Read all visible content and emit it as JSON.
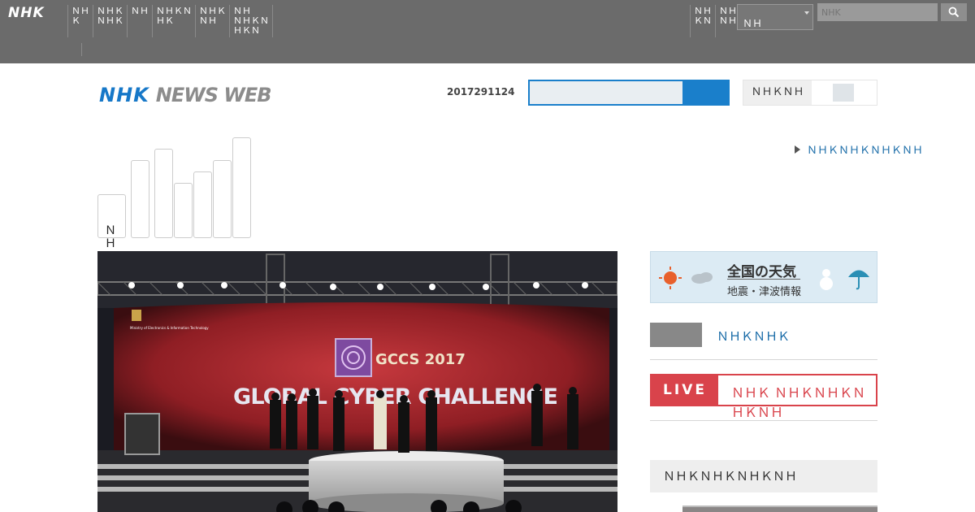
{
  "global_bar": {
    "logo": "NHK",
    "nav_items": [
      "ＮＨ\nＫ",
      "ＮＨＫ\nＮＨＫ",
      "ＮＨ",
      "ＮＨＫＮ\nＨＫ",
      "ＮＨＫ\nＮＨ",
      "ＮＨ\nＮＨＫＮ\nＨＫＮ"
    ],
    "right_items": [
      "ＮＨ\nＫＮ",
      "ＮＨＫ\nＮＨＫ"
    ],
    "region_select": "ＮＨ",
    "search_placeholder": "NHK"
  },
  "header": {
    "logo_nhk": "NHK",
    "logo_news": "NEWS WEB",
    "date": "2017291124",
    "language_label": "ＮＨＫＮＨ"
  },
  "topic_link": "ＮＨＫＮＨＫＮＨＫＮＨ",
  "tabs": {
    "home_label": "ＮＨ\nＫＮ",
    "count": 7
  },
  "hero": {
    "banner_line1": "GCCS 2017",
    "banner_line2": "GLOBAL CYBER CHALLENGE",
    "sponsor": "Ministry of Electronics & Information Technology"
  },
  "sidebar": {
    "weather_title": "全国の天気",
    "weather_subtitle": "地震・津波情報",
    "sub_link": "ＮＨＫＮＨＫ",
    "live_badge": "LIVE",
    "live_text": "ＮＨＫ ＮＨＫＮＨＫＮＨＫＮＨ",
    "ranking_title": "ＮＨＫＮＨＫＮＨＫＮＨ"
  },
  "colors": {
    "global_bar": "#6b6b6b",
    "brand_blue": "#1778c8",
    "live_red": "#d9434b"
  }
}
